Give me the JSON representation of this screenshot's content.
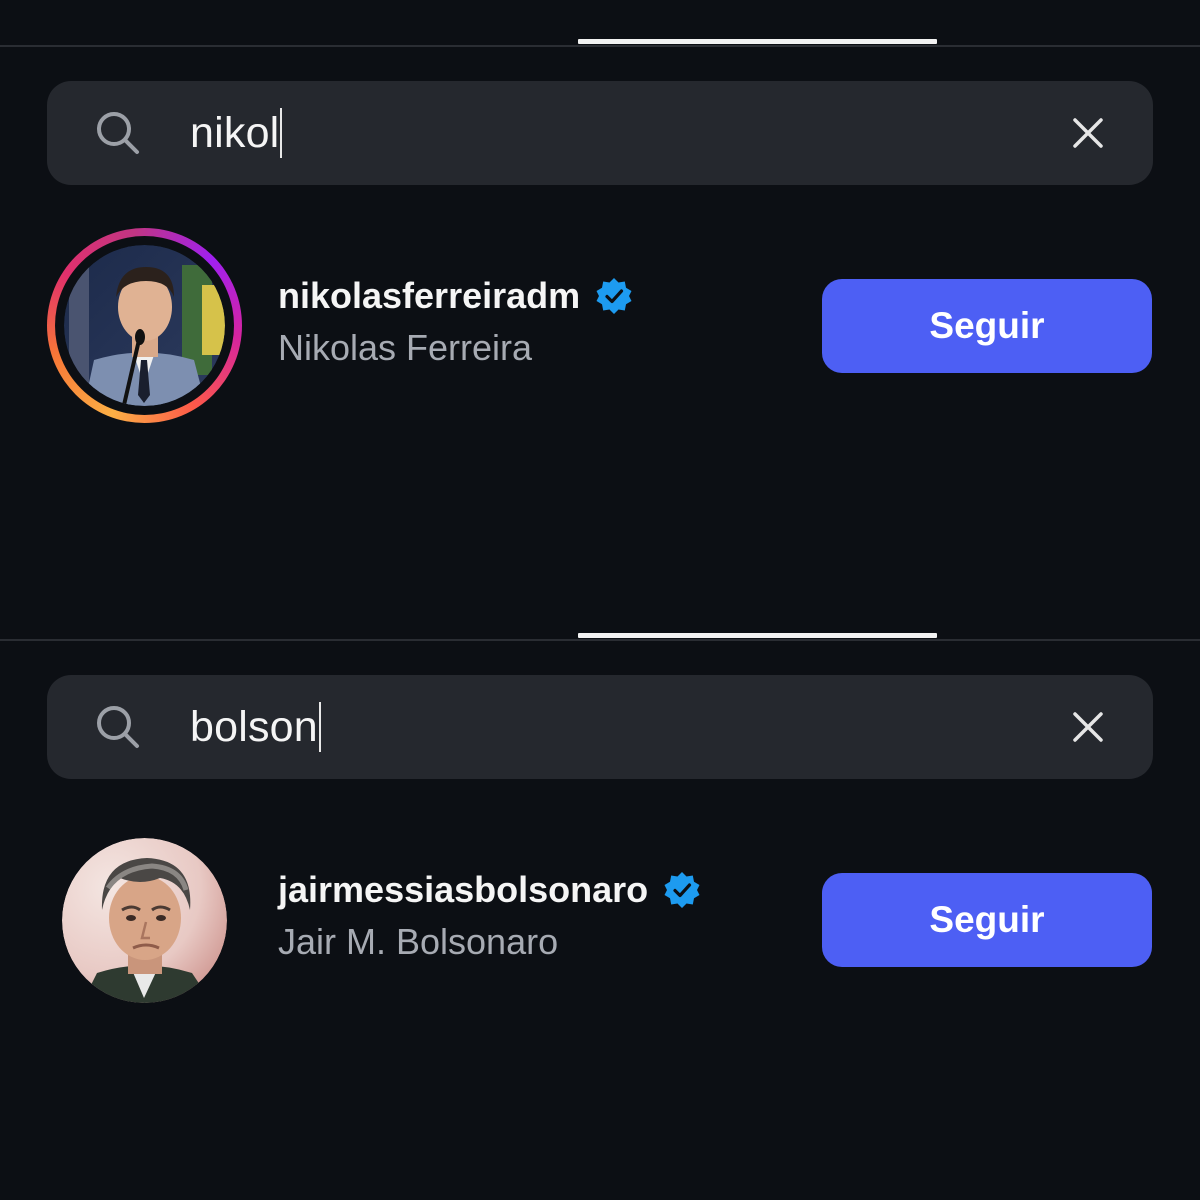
{
  "panels": [
    {
      "search": {
        "value": "nikol"
      },
      "result": {
        "username": "nikolasferreiradm",
        "full_name": "Nikolas Ferreira",
        "verified": true,
        "follow_label": "Seguir",
        "has_story_ring": true
      }
    },
    {
      "search": {
        "value": "bolson"
      },
      "result": {
        "username": "jairmessiasbolsonaro",
        "full_name": "Jair M. Bolsonaro",
        "verified": true,
        "follow_label": "Seguir",
        "has_story_ring": false
      }
    }
  ],
  "colors": {
    "background": "#0c0f14",
    "search_bar": "#25282e",
    "follow_button": "#4d5ff4",
    "verified_badge": "#1d9bf0",
    "secondary_text": "#a7abb3"
  },
  "icons": {
    "search": "search-icon",
    "clear": "close-icon",
    "verified": "verified-badge-icon"
  }
}
